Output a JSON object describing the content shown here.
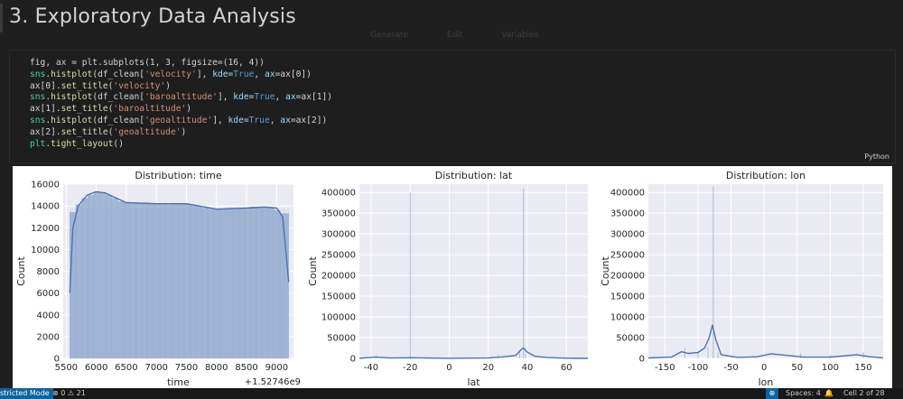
{
  "heading": {
    "title": "3. Exploratory Data Analysis"
  },
  "toolbar": {
    "items": [
      "Generate",
      "Edit",
      "Variables"
    ]
  },
  "code_cell": {
    "language": "Python",
    "lines": [
      [
        [
          "fig, ax = plt.subplots(1, 3, figsize=(16, 4))",
          "#d4d4d4"
        ]
      ],
      [
        [
          "sns",
          "#4ec9b0"
        ],
        [
          ".",
          "#d4d4d4"
        ],
        [
          "histplot",
          "#dcdcaa"
        ],
        [
          "(df_clean[",
          "#d4d4d4"
        ],
        [
          "'velocity'",
          "#ce9178"
        ],
        [
          "], ",
          "#d4d4d4"
        ],
        [
          "kde",
          "#9cdcfe"
        ],
        [
          "=",
          "#d4d4d4"
        ],
        [
          "True",
          "#569cd6"
        ],
        [
          ", ",
          "#d4d4d4"
        ],
        [
          "ax",
          "#9cdcfe"
        ],
        [
          "=ax[0])",
          "#d4d4d4"
        ]
      ],
      [
        [
          "ax[0].",
          "#d4d4d4"
        ],
        [
          "set_title",
          "#dcdcaa"
        ],
        [
          "(",
          "#d4d4d4"
        ],
        [
          "'velocity'",
          "#ce9178"
        ],
        [
          ")",
          "#d4d4d4"
        ]
      ],
      [
        [
          "sns",
          "#4ec9b0"
        ],
        [
          ".",
          "#d4d4d4"
        ],
        [
          "histplot",
          "#dcdcaa"
        ],
        [
          "(df_clean[",
          "#d4d4d4"
        ],
        [
          "'baroaltitude'",
          "#ce9178"
        ],
        [
          "], ",
          "#d4d4d4"
        ],
        [
          "kde",
          "#9cdcfe"
        ],
        [
          "=",
          "#d4d4d4"
        ],
        [
          "True",
          "#569cd6"
        ],
        [
          ", ",
          "#d4d4d4"
        ],
        [
          "ax",
          "#9cdcfe"
        ],
        [
          "=ax[1])",
          "#d4d4d4"
        ]
      ],
      [
        [
          "ax[1].",
          "#d4d4d4"
        ],
        [
          "set_title",
          "#dcdcaa"
        ],
        [
          "(",
          "#d4d4d4"
        ],
        [
          "'baroaltitude'",
          "#ce9178"
        ],
        [
          ")",
          "#d4d4d4"
        ]
      ],
      [
        [
          "sns",
          "#4ec9b0"
        ],
        [
          ".",
          "#d4d4d4"
        ],
        [
          "histplot",
          "#dcdcaa"
        ],
        [
          "(df_clean[",
          "#d4d4d4"
        ],
        [
          "'geoaltitude'",
          "#ce9178"
        ],
        [
          "], ",
          "#d4d4d4"
        ],
        [
          "kde",
          "#9cdcfe"
        ],
        [
          "=",
          "#d4d4d4"
        ],
        [
          "True",
          "#569cd6"
        ],
        [
          ", ",
          "#d4d4d4"
        ],
        [
          "ax",
          "#9cdcfe"
        ],
        [
          "=ax[2])",
          "#d4d4d4"
        ]
      ],
      [
        [
          "ax[2].",
          "#d4d4d4"
        ],
        [
          "set_title",
          "#dcdcaa"
        ],
        [
          "(",
          "#d4d4d4"
        ],
        [
          "'geoaltitude'",
          "#ce9178"
        ],
        [
          ")",
          "#d4d4d4"
        ]
      ],
      [
        [
          "plt",
          "#4ec9b0"
        ],
        [
          ".",
          "#d4d4d4"
        ],
        [
          "tight_layout",
          "#dcdcaa"
        ],
        [
          "()",
          "#d4d4d4"
        ]
      ]
    ]
  },
  "chart_data": [
    {
      "type": "bar",
      "title": "Distribution: time",
      "xlabel": "time",
      "ylabel": "Count",
      "offset_label": "+1.52746e9",
      "xlim": [
        5450,
        9280
      ],
      "ylim": [
        0,
        16000
      ],
      "xticks": [
        5500,
        6000,
        6500,
        7000,
        7500,
        8000,
        8500,
        9000
      ],
      "yticks": [
        0,
        2000,
        4000,
        6000,
        8000,
        10000,
        12000,
        14000,
        16000
      ],
      "hist_range": [
        5560,
        9200
      ],
      "kde": [
        [
          5560,
          6000
        ],
        [
          5610,
          12000
        ],
        [
          5700,
          14000
        ],
        [
          5850,
          15000
        ],
        [
          6000,
          15300
        ],
        [
          6150,
          15200
        ],
        [
          6300,
          14800
        ],
        [
          6500,
          14300
        ],
        [
          7000,
          14200
        ],
        [
          7500,
          14200
        ],
        [
          7700,
          14000
        ],
        [
          8000,
          13700
        ],
        [
          8500,
          13800
        ],
        [
          8800,
          13900
        ],
        [
          9000,
          13800
        ],
        [
          9100,
          13000
        ],
        [
          9160,
          9500
        ],
        [
          9200,
          7000
        ]
      ],
      "bars": [
        [
          5560,
          5660,
          13400
        ],
        [
          5660,
          5760,
          14100
        ],
        [
          5760,
          5860,
          14700
        ],
        [
          5860,
          5960,
          15000
        ],
        [
          5960,
          6060,
          15300
        ],
        [
          6060,
          6160,
          15200
        ],
        [
          6160,
          6260,
          15000
        ],
        [
          6260,
          6360,
          14700
        ],
        [
          6360,
          6460,
          14400
        ],
        [
          6460,
          6560,
          14300
        ],
        [
          6560,
          6660,
          14300
        ],
        [
          6660,
          6760,
          14200
        ],
        [
          6760,
          6860,
          14300
        ],
        [
          6860,
          6960,
          14200
        ],
        [
          6960,
          7060,
          14200
        ],
        [
          7060,
          7160,
          14200
        ],
        [
          7160,
          7260,
          14100
        ],
        [
          7260,
          7360,
          14200
        ],
        [
          7360,
          7460,
          14200
        ],
        [
          7460,
          7560,
          14200
        ],
        [
          7560,
          7660,
          14100
        ],
        [
          7660,
          7760,
          14000
        ],
        [
          7760,
          7860,
          13800
        ],
        [
          7860,
          7960,
          13700
        ],
        [
          7960,
          8060,
          13700
        ],
        [
          8060,
          8160,
          13700
        ],
        [
          8160,
          8260,
          13800
        ],
        [
          8260,
          8360,
          13800
        ],
        [
          8360,
          8460,
          13800
        ],
        [
          8460,
          8560,
          13800
        ],
        [
          8560,
          8660,
          13900
        ],
        [
          8660,
          8760,
          13900
        ],
        [
          8760,
          8860,
          13900
        ],
        [
          8860,
          8960,
          13800
        ],
        [
          8960,
          9060,
          13600
        ],
        [
          9060,
          9200,
          13300
        ]
      ]
    },
    {
      "type": "bar",
      "title": "Distribution: lat",
      "xlabel": "lat",
      "ylabel": "Count",
      "xlim": [
        -46,
        71
      ],
      "ylim": [
        0,
        420000
      ],
      "xticks": [
        -40,
        -20,
        0,
        20,
        40,
        60
      ],
      "yticks": [
        0,
        50000,
        100000,
        150000,
        200000,
        250000,
        300000,
        350000,
        400000
      ],
      "spikes": [
        [
          38,
          410000
        ],
        [
          -20,
          400000
        ],
        [
          -37.5,
          7000
        ],
        [
          25,
          10000
        ],
        [
          36,
          16000
        ],
        [
          39,
          12000
        ]
      ],
      "kde": [
        [
          -46,
          200
        ],
        [
          -38,
          3000
        ],
        [
          -30,
          800
        ],
        [
          -20,
          1500
        ],
        [
          0,
          300
        ],
        [
          20,
          900
        ],
        [
          28,
          4000
        ],
        [
          34,
          7000
        ],
        [
          37,
          22000
        ],
        [
          38,
          25000
        ],
        [
          40,
          15000
        ],
        [
          44,
          5000
        ],
        [
          50,
          2500
        ],
        [
          60,
          500
        ],
        [
          71,
          100
        ]
      ]
    },
    {
      "type": "bar",
      "title": "Distribution: lon",
      "xlabel": "lon",
      "ylabel": "Count",
      "xlim": [
        -175,
        180
      ],
      "ylim": [
        0,
        420000
      ],
      "xticks": [
        -150,
        -100,
        -50,
        0,
        50,
        100,
        150
      ],
      "yticks": [
        0,
        50000,
        100000,
        150000,
        200000,
        250000,
        300000,
        350000,
        400000
      ],
      "spikes": [
        [
          -77,
          415000
        ],
        [
          -120,
          25000
        ],
        [
          -100,
          18000
        ],
        [
          -85,
          28000
        ],
        [
          -70,
          14000
        ],
        [
          55,
          13000
        ],
        [
          100,
          8000
        ],
        [
          150,
          15000
        ]
      ],
      "kde": [
        [
          -175,
          1000
        ],
        [
          -140,
          3000
        ],
        [
          -125,
          16000
        ],
        [
          -115,
          12000
        ],
        [
          -100,
          14000
        ],
        [
          -90,
          25000
        ],
        [
          -83,
          50000
        ],
        [
          -78,
          80000
        ],
        [
          -73,
          45000
        ],
        [
          -65,
          9000
        ],
        [
          -40,
          2500
        ],
        [
          -10,
          4000
        ],
        [
          10,
          11000
        ],
        [
          30,
          8000
        ],
        [
          60,
          3000
        ],
        [
          100,
          3000
        ],
        [
          140,
          9000
        ],
        [
          160,
          4000
        ],
        [
          180,
          1000
        ]
      ]
    }
  ],
  "status_bar": {
    "mode": "stricted Mode",
    "errors": "0",
    "warnings": "21",
    "spaces": "Spaces: 4",
    "cell": "Cell 2 of 28"
  }
}
